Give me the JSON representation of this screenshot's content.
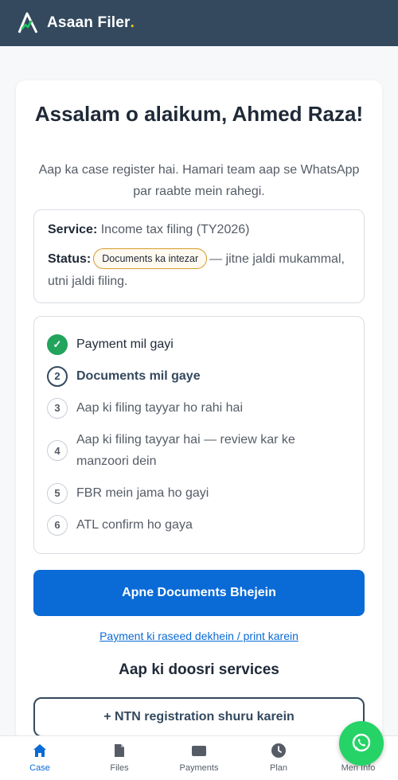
{
  "header": {
    "brand": "Asaan Filer",
    "brand_dot": ".",
    "logo_icon": "chart-mountain-logo",
    "accent_color": "#f5c518",
    "bar_color": "#34495e"
  },
  "greeting": {
    "title": "Assalam o alaikum, Ahmed Raza!",
    "subtitle": "Aap ka case register hai. Hamari team aap se WhatsApp par raabte mein rahegi."
  },
  "service": {
    "label": "Service:",
    "value": "Income tax filing (TY2026)",
    "status_label": "Status:",
    "status_badge": "Documents ka intezar",
    "status_note": "— jitne jaldi mukammal, utni jaldi filing."
  },
  "steps": [
    {
      "number": "✓",
      "label": "Payment mil gayi",
      "state": "done"
    },
    {
      "number": "2",
      "label": "Documents mil gaye",
      "state": "current"
    },
    {
      "number": "3",
      "label": "Aap ki filing tayyar ho rahi hai",
      "state": "pending"
    },
    {
      "number": "4",
      "label": "Aap ki filing tayyar hai — review kar ke manzoori dein",
      "state": "pending"
    },
    {
      "number": "5",
      "label": "FBR mein jama ho gayi",
      "state": "pending"
    },
    {
      "number": "6",
      "label": "ATL confirm ho gaya",
      "state": "pending"
    }
  ],
  "actions": {
    "primary": "Apne Documents Bhejein",
    "receipt_link": "Payment ki raseed dekhein / print karein",
    "other_services_title": "Aap ki doosri services",
    "ntn_button": "+ NTN registration shuru karein"
  },
  "nav": {
    "items": [
      {
        "label": "Case",
        "icon": "home-icon",
        "active": true
      },
      {
        "label": "Files",
        "icon": "file-icon",
        "active": false
      },
      {
        "label": "Payments",
        "icon": "card-icon",
        "active": false
      },
      {
        "label": "Plan",
        "icon": "clock-icon",
        "active": false
      },
      {
        "label": "Meri Info",
        "icon": "user-icon",
        "active": false
      }
    ]
  },
  "whatsapp": {
    "icon": "whatsapp-icon",
    "color": "#25d366"
  },
  "colors": {
    "primary": "#0a6ad6",
    "success": "#22a45d",
    "badge_border": "#d99a2b"
  }
}
